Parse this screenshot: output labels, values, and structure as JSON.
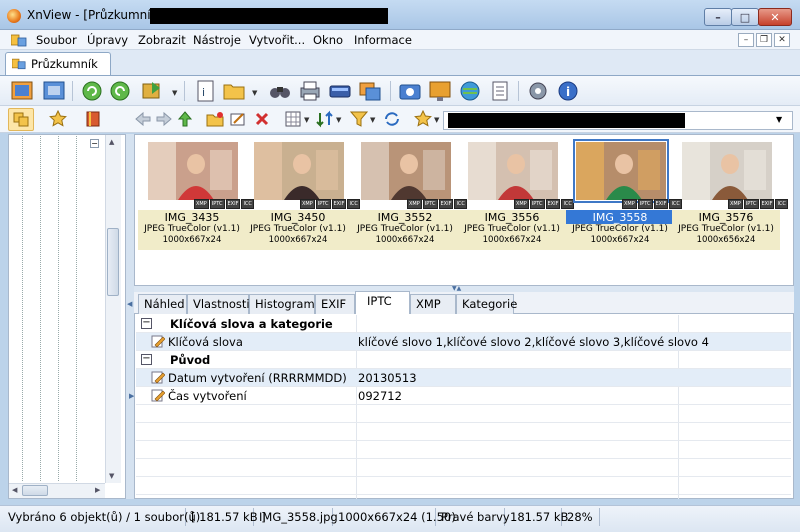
{
  "window": {
    "title": "XnView - [Průzkumník - ",
    "controls": {
      "minimize": "–",
      "maximize": "□",
      "close": "✕"
    }
  },
  "menu": [
    "Soubor",
    "Úpravy",
    "Zobrazit",
    "Nástroje",
    "Vytvořit...",
    "Okno",
    "Informace"
  ],
  "tab": {
    "label": "Průzkumník"
  },
  "thumbnails": [
    {
      "name": "IMG_3435",
      "format": "JPEG TrueColor (v1.1)",
      "dims": "1000x667x24",
      "selected": false,
      "palette": [
        "#caa08c",
        "#d03838",
        "#f0e0d0"
      ]
    },
    {
      "name": "IMG_3450",
      "format": "JPEG TrueColor (v1.1)",
      "dims": "1000x667x24",
      "selected": false,
      "palette": [
        "#c9b090",
        "#3a2a2a",
        "#e7c6a6"
      ]
    },
    {
      "name": "IMG_3552",
      "format": "JPEG TrueColor (v1.1)",
      "dims": "1000x667x24",
      "selected": false,
      "palette": [
        "#b99478",
        "#503830",
        "#e2d4c8"
      ]
    },
    {
      "name": "IMG_3556",
      "format": "JPEG TrueColor (v1.1)",
      "dims": "1000x667x24",
      "selected": false,
      "palette": [
        "#d4c0b0",
        "#c23838",
        "#f0e8e0"
      ]
    },
    {
      "name": "IMG_3558",
      "format": "JPEG TrueColor (v1.1)",
      "dims": "1000x667x24",
      "selected": true,
      "palette": [
        "#b68d6a",
        "#2a8a4a",
        "#e9b05a"
      ]
    },
    {
      "name": "IMG_3576",
      "format": "JPEG TrueColor (v1.1)",
      "dims": "1000x656x24",
      "selected": false,
      "palette": [
        "#d6d0c8",
        "#8a5a3a",
        "#f0ece4"
      ]
    }
  ],
  "badges": [
    "XMP",
    "IPTC",
    "EXIF",
    "ICC"
  ],
  "info_tabs": [
    "Náhled",
    "Vlastnosti",
    "Histogram",
    "EXIF",
    "IPTC",
    "XMP",
    "Kategorie"
  ],
  "active_info_tab": "IPTC",
  "grid": {
    "section1": "Klíčová slova a kategorie",
    "keywords_label": "Klíčová slova",
    "keywords_value": "klíčové slovo 1,klíčové slovo 2,klíčové slovo 3,klíčové slovo 4",
    "section2": "Původ",
    "date_label": "Datum vytvoření (RRRRMMDD)",
    "date_value": "20130513",
    "time_label": "Čas vytvoření",
    "time_value": "092712",
    "expander": "−"
  },
  "status": [
    "Vybráno 6 objekt(ů) / 1 soubor(ů)",
    "[ 181.57 kB ]",
    "IMG_3558.jpg",
    "1000x667x24 (1.50)",
    "Pravé barvy",
    "181.57 kB",
    "28%"
  ],
  "colors": {
    "accent": "#3478d6",
    "meta_bg": "#f1ecc9",
    "window_bg": "#bcd3ea"
  }
}
